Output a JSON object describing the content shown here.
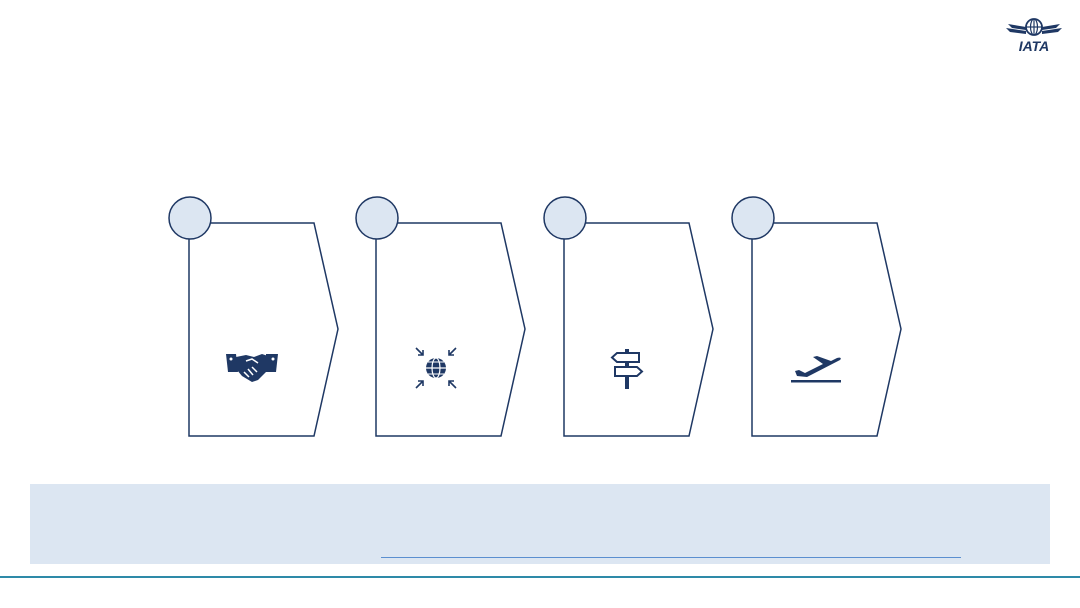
{
  "brand": {
    "logo_text": "IATA",
    "navy": "#1f3864",
    "circle_fill": "#dce6f2",
    "banner_fill": "#dce6f2",
    "footer_line": "#2e8aa8",
    "link_line": "#5b8fd0"
  },
  "steps": [
    {
      "number": "",
      "icon": "handshake-icon"
    },
    {
      "number": "",
      "icon": "globe-arrows-icon"
    },
    {
      "number": "",
      "icon": "signpost-icon"
    },
    {
      "number": "",
      "icon": "airplane-takeoff-icon"
    }
  ],
  "banner": {
    "text": ""
  }
}
